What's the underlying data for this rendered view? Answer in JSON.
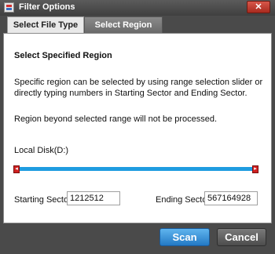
{
  "window": {
    "title": "Filter Options",
    "close_label": "✕"
  },
  "tabs": [
    {
      "label": "Select File Type",
      "active": false
    },
    {
      "label": "Select Region",
      "active": true
    }
  ],
  "region": {
    "heading": "Select Specified Region",
    "description": "Specific region can be selected by using range selection slider or directly typing numbers in Starting Sector and Ending Sector.",
    "note": "Region beyond selected range will not be processed.",
    "disk_label": "Local Disk(D:)",
    "slider": {
      "left_arrow": "◂",
      "right_arrow": "▸"
    },
    "starting_sector_label": "Starting Sector",
    "starting_sector_value": "1212512",
    "ending_sector_label": "Ending Sector",
    "ending_sector_value": "567164928"
  },
  "buttons": {
    "scan": "Scan",
    "cancel": "Cancel"
  },
  "colors": {
    "slider_track": "#1f9ce0",
    "slider_handle": "#d02020",
    "scan": "#2f86d0"
  }
}
